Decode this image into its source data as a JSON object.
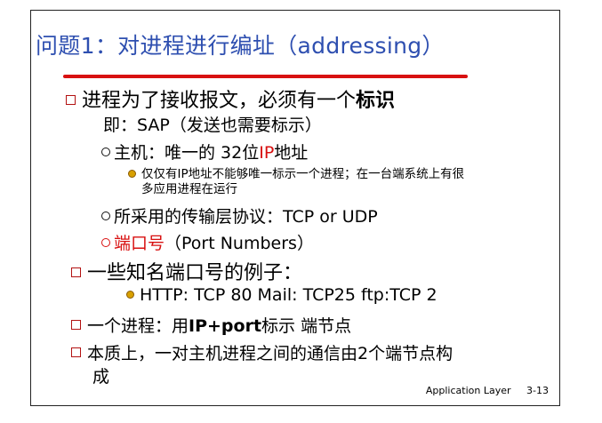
{
  "title": {
    "prefix": "问题",
    "number": "1",
    "colon_text": "：对进程进行编址（",
    "latin": "addressing",
    "close": "）"
  },
  "bullets": {
    "b1": {
      "text": "进程为了接收报文，必须有一个",
      "strong": "标识"
    },
    "b1_sub": "即：SAP（发送也需要标示）",
    "b1_host": {
      "prefix": "主机：唯一的 32位",
      "ip": "IP",
      "suffix": "地址"
    },
    "b1_host_note_1": "仅仅有IP地址不能够唯一标示一个进程；在一台端系统上有很",
    "b1_host_note_2": "多应用进程在运行",
    "b1_protocol": "所采用的传输层协议：TCP or UDP",
    "b1_port": {
      "red": "端口号",
      "rest": "（Port Numbers）"
    },
    "b2": "一些知名端口号的例子：",
    "b2_example": "HTTP: TCP 80 Mail: TCP25 ftp:TCP 2",
    "b3": {
      "text": "一个进程：用",
      "bold": "IP+port",
      "rest": "标示 端节点"
    },
    "b4_1": "本质上，一对主机进程之间的通信由2个端节点构",
    "b4_2": "成"
  },
  "footer": {
    "label": "Application Layer",
    "page": "3-13"
  },
  "colors": {
    "title": "#2e4fb0",
    "accent_red": "#d81010",
    "bullet_box": "#b31212"
  }
}
